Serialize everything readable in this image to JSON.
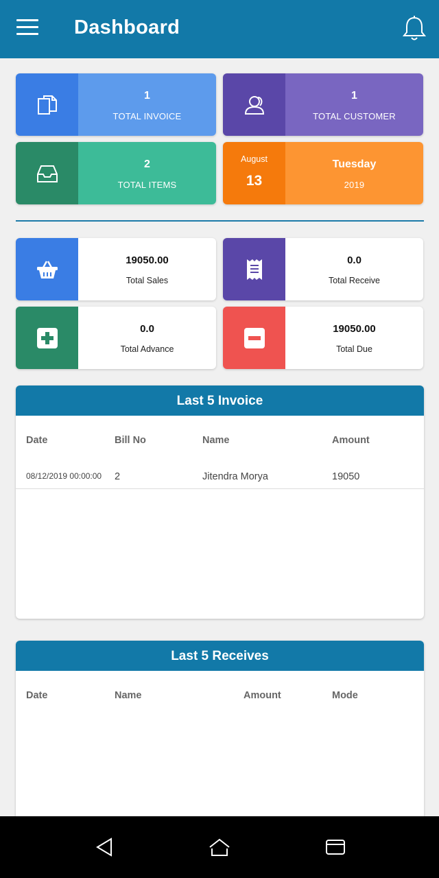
{
  "header": {
    "title": "Dashboard",
    "menu_icon": "hamburger-menu-icon",
    "bell_icon": "bell-icon"
  },
  "stats": {
    "invoice": {
      "value": "1",
      "label": "TOTAL INVOICE",
      "icon": "documents-icon",
      "icon_bg": "#3a7de4",
      "bg": "#5d9bec"
    },
    "customer": {
      "value": "1",
      "label": "TOTAL CUSTOMER",
      "icon": "users-icon",
      "icon_bg": "#5a47a8",
      "bg": "#7966c1"
    },
    "items": {
      "value": "2",
      "label": "TOTAL ITEMS",
      "icon": "inbox-icon",
      "icon_bg": "#2a8a67",
      "bg": "#3dbb98"
    },
    "date": {
      "month": "August",
      "day": "13",
      "weekday": "Tuesday",
      "year": "2019",
      "icon_bg": "#f57a0c",
      "bg": "#fd9532"
    }
  },
  "summary": {
    "sales": {
      "value": "19050.00",
      "label": "Total Sales",
      "icon": "basket-icon",
      "icon_bg": "#3a7de4"
    },
    "receive": {
      "value": "0.0",
      "label": "Total Receive",
      "icon": "receipt-icon",
      "icon_bg": "#5a47a8"
    },
    "advance": {
      "value": "0.0",
      "label": "Total Advance",
      "icon": "plus-square-icon",
      "icon_bg": "#2a8a67"
    },
    "due": {
      "value": "19050.00",
      "label": "Total Due",
      "icon": "minus-square-icon",
      "icon_bg": "#ef5350"
    }
  },
  "invoices": {
    "title": "Last 5 Invoice",
    "columns": [
      "Date",
      "Bill No",
      "Name",
      "Amount"
    ],
    "rows": [
      {
        "date": "08/12/2019 00:00:00",
        "bill_no": "2",
        "name": "Jitendra Morya",
        "amount": "19050"
      }
    ]
  },
  "receives": {
    "title": "Last 5 Receives",
    "columns": [
      "Date",
      "Name",
      "Amount",
      "Mode"
    ]
  },
  "navbar": {
    "back_icon": "back-triangle-icon",
    "home_icon": "home-icon",
    "recents_icon": "recents-icon"
  },
  "colors": {
    "primary": "#1279a8",
    "background": "#f0f0f0"
  }
}
